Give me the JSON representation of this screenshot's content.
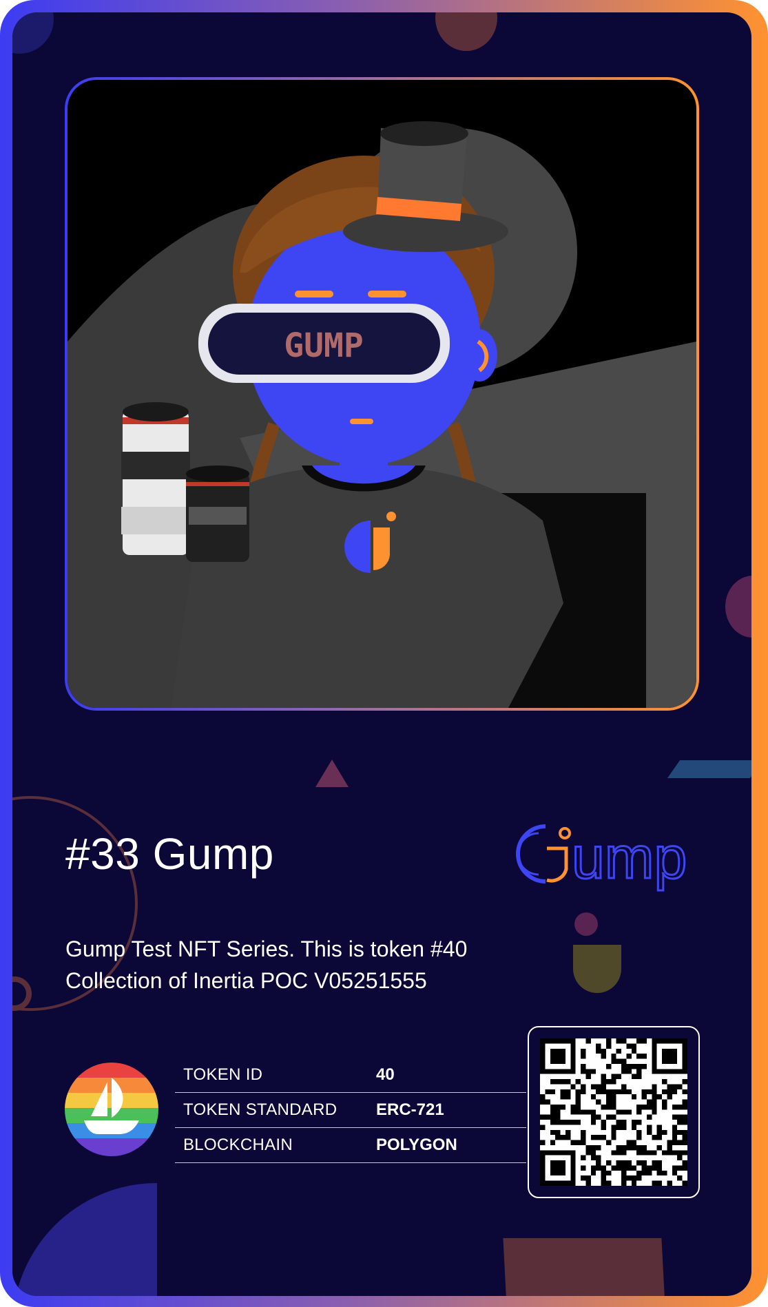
{
  "card": {
    "title": "#33 Gump",
    "description_line1": "Gump Test NFT Series. This is token #40",
    "description_line2": "Collection of Inertia POC V05251555",
    "visor_text": "GUMP"
  },
  "brand": {
    "logo_text": "ump",
    "logo_icon": "gump-g-icon"
  },
  "metadata": [
    {
      "key": "TOKEN ID",
      "value": "40"
    },
    {
      "key": "TOKEN STANDARD",
      "value": "ERC-721"
    },
    {
      "key": "BLOCKCHAIN",
      "value": "POLYGON"
    }
  ],
  "icons": {
    "marketplace": "opensea-boat-icon",
    "qr": "qr-code"
  },
  "colors": {
    "background": "#0b0737",
    "accent_blue": "#3d3cf2",
    "accent_orange": "#ff9230",
    "avatar_skin": "#3e45f2"
  }
}
